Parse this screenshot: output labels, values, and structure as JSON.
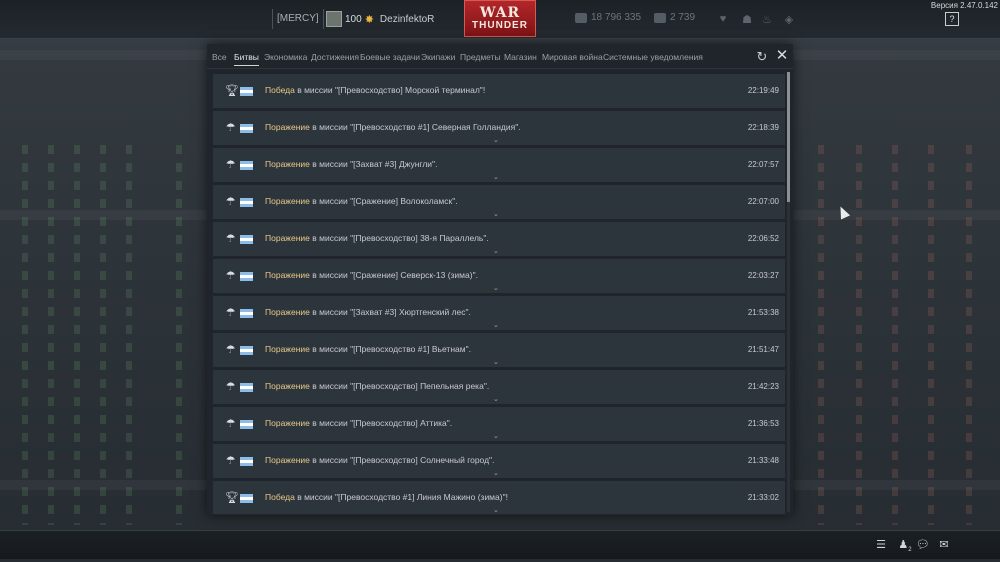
{
  "app": {
    "version": "Версия 2.47.0.142",
    "help_label": "?"
  },
  "player": {
    "squad": "[MERCY]",
    "level": "100",
    "nickname": "DezinfektoR"
  },
  "logo": {
    "line1": "WAR",
    "line2": "THUNDER"
  },
  "currency": {
    "silver_lions": "18 796 335",
    "golden_eagles": "2 739"
  },
  "tabs": [
    {
      "label": "Все",
      "active": false
    },
    {
      "label": "Битвы",
      "active": true
    },
    {
      "label": "Экономика",
      "active": false
    },
    {
      "label": "Достижения",
      "active": false
    },
    {
      "label": "Боевые задачи",
      "active": false
    },
    {
      "label": "Экипажи",
      "active": false
    },
    {
      "label": "Предметы",
      "active": false
    },
    {
      "label": "Магазин",
      "active": false
    },
    {
      "label": "Мировая война",
      "active": false
    },
    {
      "label": "Системные уведомления",
      "active": false
    }
  ],
  "entries": [
    {
      "icon": "trophy-icon",
      "result": "Победа",
      "text": " в миссии \"[Превосходство] Морской терминал\"!",
      "time": "22:19:49"
    },
    {
      "icon": "parachute-icon",
      "result": "Поражение",
      "text": " в миссии \"[Превосходство #1] Северная Голландия\".",
      "time": "22:18:39"
    },
    {
      "icon": "parachute-icon",
      "result": "Поражение",
      "text": " в миссии \"[Захват #3] Джунгли\".",
      "time": "22:07:57"
    },
    {
      "icon": "parachute-icon",
      "result": "Поражение",
      "text": " в миссии \"[Сражение] Волоколамск\".",
      "time": "22:07:00"
    },
    {
      "icon": "parachute-icon",
      "result": "Поражение",
      "text": " в миссии \"[Превосходство] 38-я Параллель\".",
      "time": "22:06:52"
    },
    {
      "icon": "parachute-icon",
      "result": "Поражение",
      "text": " в миссии \"[Сражение] Северск-13 (зима)\".",
      "time": "22:03:27"
    },
    {
      "icon": "parachute-icon",
      "result": "Поражение",
      "text": " в миссии \"[Захват #3] Хюртгенский лес\".",
      "time": "21:53:38"
    },
    {
      "icon": "parachute-icon",
      "result": "Поражение",
      "text": " в миссии \"[Превосходство #1] Вьетнам\".",
      "time": "21:51:47"
    },
    {
      "icon": "parachute-icon",
      "result": "Поражение",
      "text": " в миссии \"[Превосходство] Пепельная река\".",
      "time": "21:42:23"
    },
    {
      "icon": "parachute-icon",
      "result": "Поражение",
      "text": " в миссии \"[Превосходство] Аттика\".",
      "time": "21:36:53"
    },
    {
      "icon": "parachute-icon",
      "result": "Поражение",
      "text": " в миссии \"[Превосходство] Солнечный город\".",
      "time": "21:33:48"
    },
    {
      "icon": "trophy-icon",
      "result": "Победа",
      "text": " в миссии \"[Превосходство #1] Линия Мажино (зима)\"!",
      "time": "21:33:02"
    }
  ],
  "bottom": {
    "squad_count": "2"
  }
}
